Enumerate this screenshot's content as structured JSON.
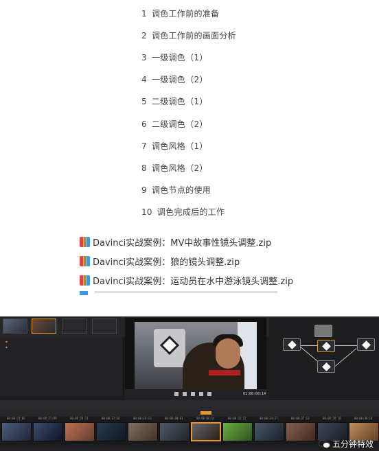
{
  "lessons": [
    {
      "num": "1",
      "title": "调色工作前的准备"
    },
    {
      "num": "2",
      "title": "调色工作前的画面分析"
    },
    {
      "num": "3",
      "title": "一级调色（1）"
    },
    {
      "num": "4",
      "title": "一级调色（2）"
    },
    {
      "num": "5",
      "title": "二级调色（1）"
    },
    {
      "num": "6",
      "title": "二级调色（2）"
    },
    {
      "num": "7",
      "title": "调色风格（1）"
    },
    {
      "num": "8",
      "title": "调色风格（2）"
    },
    {
      "num": "9",
      "title": "调色节点的使用"
    },
    {
      "num": "10",
      "title": "调色完成后的工作"
    }
  ],
  "files": [
    {
      "name": "Davinci实战案例：MV中故事性镜头调整.zip",
      "icon": "zip-archive-icon"
    },
    {
      "name": "Davinci实战案例：狼的镜头调整.zip",
      "icon": "zip-archive-icon"
    },
    {
      "name": "Davinci实战案例：运动员在水中游泳镜头调整.zip",
      "icon": "zip-archive-icon"
    }
  ],
  "resolve": {
    "timecode": "01:00:00:14",
    "accent": "#e8952a",
    "clip_timecodes": [
      "00:00:21:05",
      "00:00:22:09",
      "00:00:20:11",
      "00:00:27:16",
      "00:00:19:13",
      "00:00:00:01",
      "00:00:00:14",
      "00:00:31:22",
      "00:00:34:27",
      "00:00:37:13",
      "00:00:38:18",
      "00:00:40:14"
    ]
  },
  "watermark": {
    "text": "五分钟特效",
    "icon": "wechat-icon"
  }
}
